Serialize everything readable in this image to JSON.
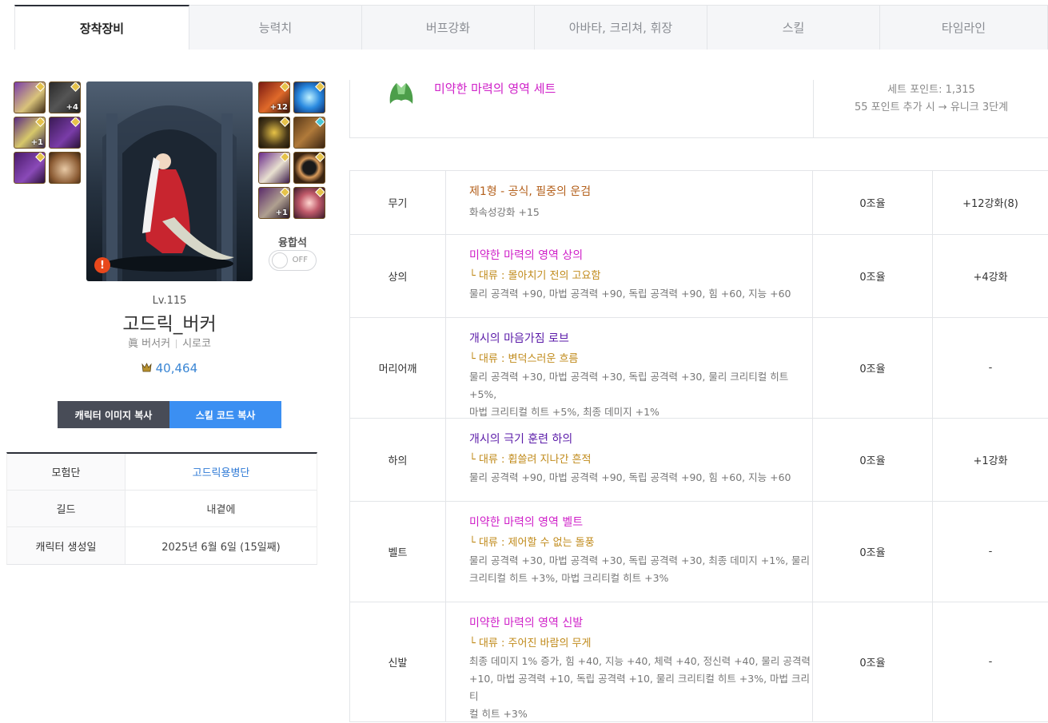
{
  "tabs": [
    "장착장비",
    "능력치",
    "버프강화",
    "아바타, 크리쳐, 휘장",
    "스킬",
    "타임라인"
  ],
  "left_slots_plus": [
    "+4",
    "+1"
  ],
  "right_slots_plus": [
    "+12",
    "+1"
  ],
  "colors": {
    "accent_blue": "#3b8ff2",
    "unique": "#cf1fc8",
    "epic": "#b35f1a",
    "legend": "#5a1aa8",
    "sub_option": "#c08a1a"
  },
  "character": {
    "level": "Lv.115",
    "name": "고드릭_버커",
    "job": "眞 버서커",
    "server": "시로코",
    "fame": "40,464",
    "fusion_label": "융합석",
    "fusion_toggle": "OFF"
  },
  "buttons": {
    "copy_image": "캐릭터 이미지 복사",
    "copy_skill": "스킬 코드 복사"
  },
  "info": [
    {
      "key": "모험단",
      "value": "고드릭용병단"
    },
    {
      "key": "길드",
      "value": "내곁에"
    },
    {
      "key": "캐릭터 생성일",
      "value": "2025년 6월 6일 (15일째)"
    }
  ],
  "set": {
    "name": "미약한 마력의 영역 세트",
    "points": "세트 포인트: 1,315",
    "next": "55 포인트 추가 시 → 유니크 3단계"
  },
  "equipment": [
    {
      "slot": "무기",
      "name": "제1형 - 공식, 필중의 운검",
      "sub": "",
      "options": [
        "화속성강화 +15"
      ],
      "fusion": "0조율",
      "enhance": "+12강화(8)"
    },
    {
      "slot": "상의",
      "name": "미약한 마력의 영역 상의",
      "sub": "└ 대류 : 몰아치기 전의 고요함",
      "options": [
        "물리 공격력 +90, 마법 공격력 +90, 독립 공격력 +90, 힘 +60, 지능 +60"
      ],
      "fusion": "0조율",
      "enhance": "+4강화"
    },
    {
      "slot": "머리어깨",
      "name": "개시의 마음가짐 로브",
      "sub": "└ 대류 : 변덕스러운 흐름",
      "options": [
        "물리 공격력 +30, 마법 공격력 +30, 독립 공격력 +30, 물리 크리티컬 히트 +5%,",
        "마법 크리티컬 히트 +5%, 최종 데미지 +1%"
      ],
      "fusion": "0조율",
      "enhance": "-"
    },
    {
      "slot": "하의",
      "name": "개시의 극기 훈련 하의",
      "sub": "└ 대류 : 휩쓸려 지나간 흔적",
      "options": [
        "물리 공격력 +90, 마법 공격력 +90, 독립 공격력 +90, 힘 +60, 지능 +60"
      ],
      "fusion": "0조율",
      "enhance": "+1강화"
    },
    {
      "slot": "벨트",
      "name": "미약한 마력의 영역 벨트",
      "sub": "└ 대류 : 제어할 수 없는 돌풍",
      "options": [
        "물리 공격력 +30, 마법 공격력 +30, 독립 공격력 +30, 최종 데미지 +1%, 물리",
        "크리티컬 히트 +3%, 마법 크리티컬 히트 +3%"
      ],
      "fusion": "0조율",
      "enhance": "-"
    },
    {
      "slot": "신발",
      "name": "미약한 마력의 영역 신발",
      "sub": "└ 대류 : 주어진 바람의 무게",
      "options": [
        "최종 데미지 1% 증가, 힘 +40, 지능 +40, 체력 +40, 정신력 +40, 물리 공격력",
        "+10, 마법 공격력 +10, 독립 공격력 +10, 물리 크리티컬 히트 +3%, 마법 크리티",
        "컬 히트 +3%"
      ],
      "fusion": "0조율",
      "enhance": "-"
    }
  ]
}
